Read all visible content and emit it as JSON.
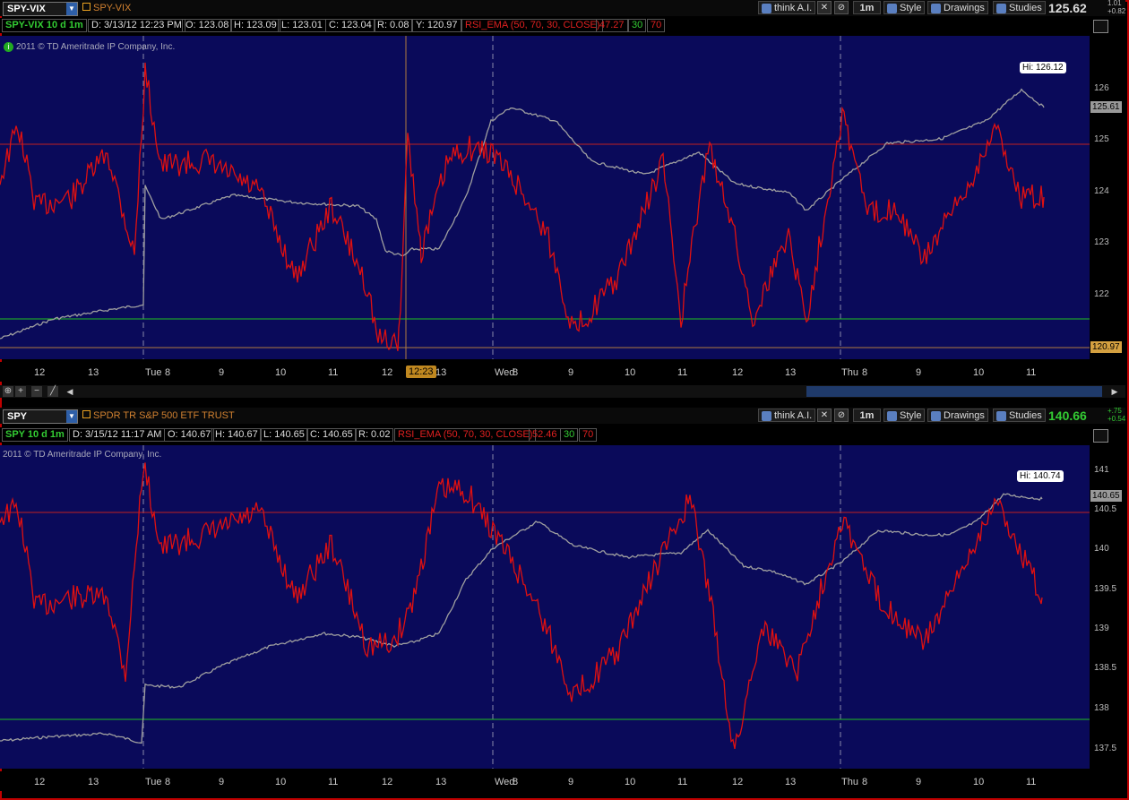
{
  "top": {
    "symbol": "SPY-VIX",
    "description": "SPY-VIX",
    "toolbar": {
      "think": "think A.I.",
      "interval": "1m",
      "style": "Style",
      "drawings": "Drawings",
      "studies": "Studies"
    },
    "last_price": "125.62",
    "change": [
      "1.01",
      "+0.82"
    ],
    "info": {
      "period": "SPY-VIX 10 d 1m",
      "date": "D: 3/13/12 12:23 PM",
      "open": "O: 123.08",
      "high": "H: 123.09",
      "low": "L: 123.01",
      "close": "C: 123.04",
      "range": "R: 0.08",
      "y": "Y: 120.97",
      "study": "RSI_EMA (50, 70, 30, CLOSE)",
      "study_val": "47.27",
      "lower": "30",
      "upper": "70"
    },
    "copyright": "2011 © TD Ameritrade IP Company, Inc.",
    "hi_label": "Hi: 126.12",
    "y_ticks": [
      "126",
      "125",
      "124",
      "123",
      "122"
    ],
    "price_tag": "125.61",
    "y_tag": "120.97",
    "x_labels": [
      "12",
      "13",
      "Tue",
      "8",
      "9",
      "10",
      "11",
      "12",
      "13",
      "Wed",
      "8",
      "9",
      "10",
      "11",
      "12",
      "13",
      "Thu",
      "8",
      "9",
      "10",
      "11"
    ],
    "cursor_time": "12:23"
  },
  "bottom": {
    "symbol": "SPY",
    "description": "SPDR TR S&P 500 ETF TRUST",
    "toolbar": {
      "think": "think A.I.",
      "interval": "1m",
      "style": "Style",
      "drawings": "Drawings",
      "studies": "Studies"
    },
    "last_price": "140.66",
    "change": [
      "+.75",
      "+0.54"
    ],
    "info": {
      "period": "SPY 10 d 1m",
      "date": "D: 3/15/12 11:17 AM",
      "open": "O: 140.67",
      "high": "H: 140.67",
      "low": "L: 140.65",
      "close": "C: 140.65",
      "range": "R: 0.02",
      "study": "RSI_EMA (50, 70, 30, CLOSE)",
      "study_val": "52.46",
      "lower": "30",
      "upper": "70"
    },
    "copyright": "2011 © TD Ameritrade IP Company, Inc.",
    "hi_label": "Hi: 140.74",
    "y_ticks": [
      "141",
      "140.5",
      "140",
      "139.5",
      "139",
      "138.5",
      "138",
      "137.5"
    ],
    "price_tag": "140.65",
    "x_labels": [
      "12",
      "13",
      "Tue",
      "8",
      "9",
      "10",
      "11",
      "12",
      "13",
      "Wed",
      "8",
      "9",
      "10",
      "11",
      "12",
      "13",
      "Thu",
      "8",
      "9",
      "10",
      "11"
    ]
  },
  "colors": {
    "bg": "#0a0a5a",
    "price": "#a0a0a0",
    "rsi": "#e01010",
    "overbought": "#c02020",
    "oversold": "#20c020",
    "accent": "#33cc33"
  }
}
